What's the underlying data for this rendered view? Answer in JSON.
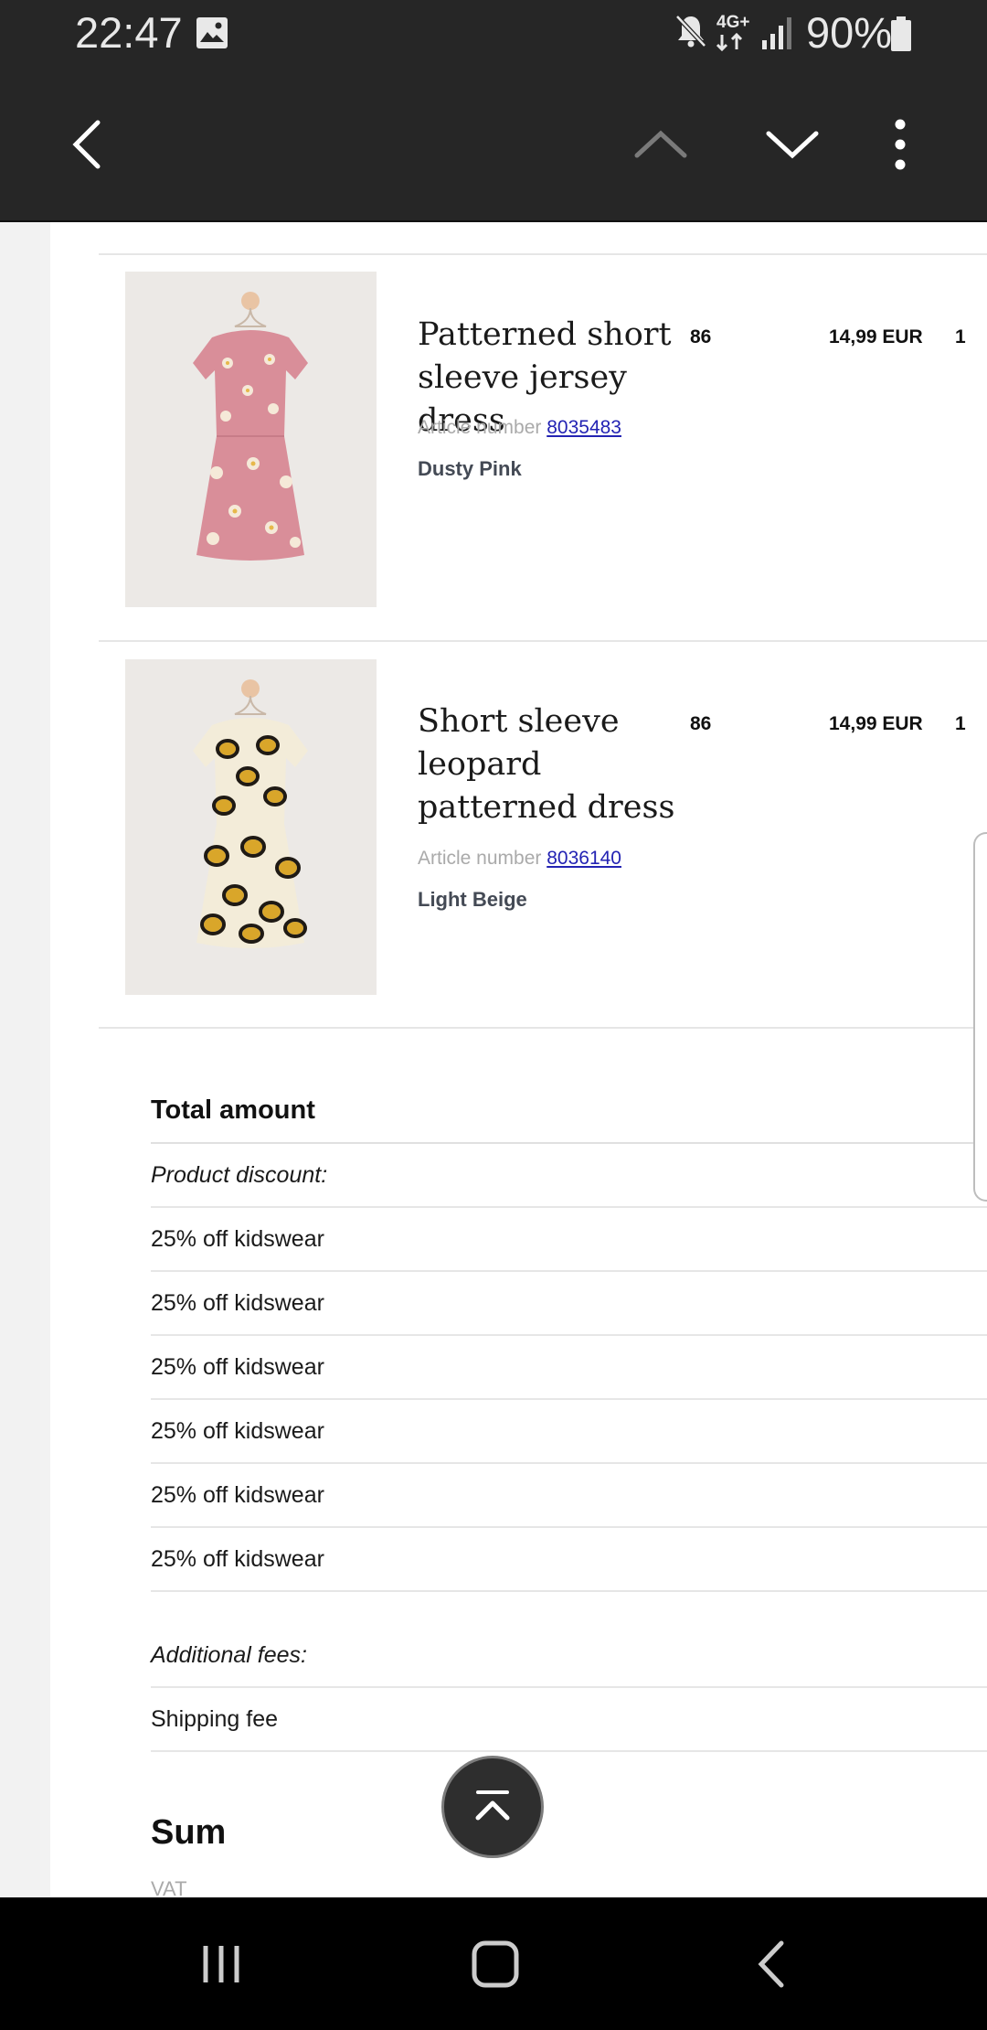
{
  "status_bar": {
    "time": "22:47",
    "network": "4G+",
    "battery": "90%",
    "icons": [
      "image-icon",
      "mute-icon",
      "signal-icon",
      "battery-icon"
    ]
  },
  "toolbar": {
    "icons": [
      "back-arrow-icon",
      "chevron-up-icon",
      "chevron-down-icon",
      "more-vert-icon"
    ]
  },
  "products": [
    {
      "name": "Patterned short sleeve jersey dress",
      "article_label": "Article number",
      "article_number": "8035483",
      "color": "Dusty Pink",
      "size": "86",
      "price": "14,99 EUR",
      "qty": "1"
    },
    {
      "name": "Short sleeve leopard patterned dress",
      "article_label": "Article number",
      "article_number": "8036140",
      "color": "Light Beige",
      "size": "86",
      "price": "14,99 EUR",
      "qty": "1"
    }
  ],
  "totals": {
    "title": "Total amount",
    "discount_label": "Product discount:",
    "discounts": [
      "25% off kidswear",
      "25% off kidswear",
      "25% off kidswear",
      "25% off kidswear",
      "25% off kidswear",
      "25% off kidswear"
    ],
    "fees_label": "Additional fees:",
    "shipping_label": "Shipping fee",
    "sum_label": "Sum",
    "vat_label": "VAT"
  },
  "colors": {
    "bar_bg": "#262626",
    "link": "#2323b3",
    "pink_dress": "#d98e99",
    "leopard_base": "#f3ecd9"
  }
}
